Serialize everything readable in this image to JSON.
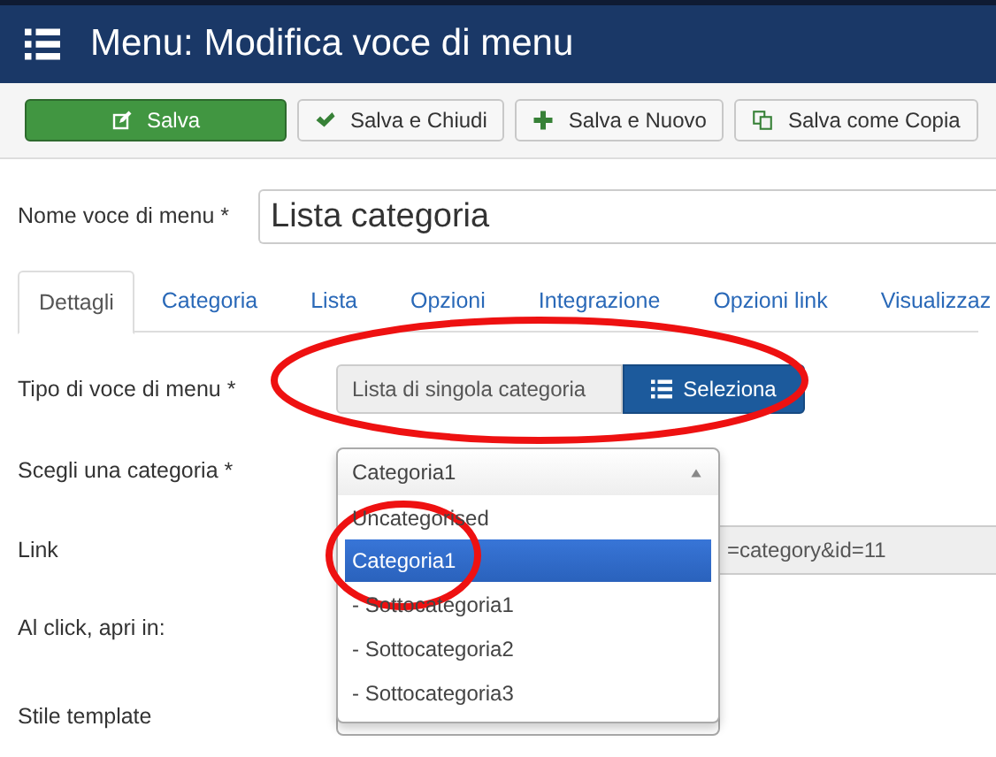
{
  "header": {
    "title": "Menu: Modifica voce di menu"
  },
  "toolbar": [
    {
      "label": "Salva",
      "kind": "primary"
    },
    {
      "label": "Salva e Chiudi",
      "kind": "check"
    },
    {
      "label": "Salva e Nuovo",
      "kind": "plus"
    },
    {
      "label": "Salva come Copia",
      "kind": "copy"
    }
  ],
  "title_field": {
    "label": "Nome voce di menu *",
    "value": "Lista categoria"
  },
  "tabs": [
    {
      "label": "Dettagli",
      "selected": true
    },
    {
      "label": "Categoria",
      "selected": false
    },
    {
      "label": "Lista",
      "selected": false
    },
    {
      "label": "Opzioni",
      "selected": false
    },
    {
      "label": "Integrazione",
      "selected": false
    },
    {
      "label": "Opzioni link",
      "selected": false
    },
    {
      "label": "Visualizzaz",
      "selected": false
    }
  ],
  "fields": [
    {
      "kind": "type",
      "label": "Tipo di voce di menu *",
      "value": "Lista di singola categoria",
      "button": "Seleziona"
    },
    {
      "kind": "select",
      "label": "Scegli una categoria *",
      "value": "Categoria1",
      "expanded": true,
      "options": [
        {
          "label": "Uncategorised",
          "selected": false
        },
        {
          "label": "Categoria1",
          "selected": true
        },
        {
          "label": "- Sottocategoria1",
          "selected": false
        },
        {
          "label": "- Sottocategoria2",
          "selected": false
        },
        {
          "label": "- Sottocategoria3",
          "selected": false
        }
      ]
    },
    {
      "kind": "text",
      "label": "Link",
      "value": "=category&id=11"
    },
    {
      "kind": "blank",
      "label": "Al click, apri in:"
    },
    {
      "kind": "covered",
      "label": "Stile template"
    }
  ]
}
